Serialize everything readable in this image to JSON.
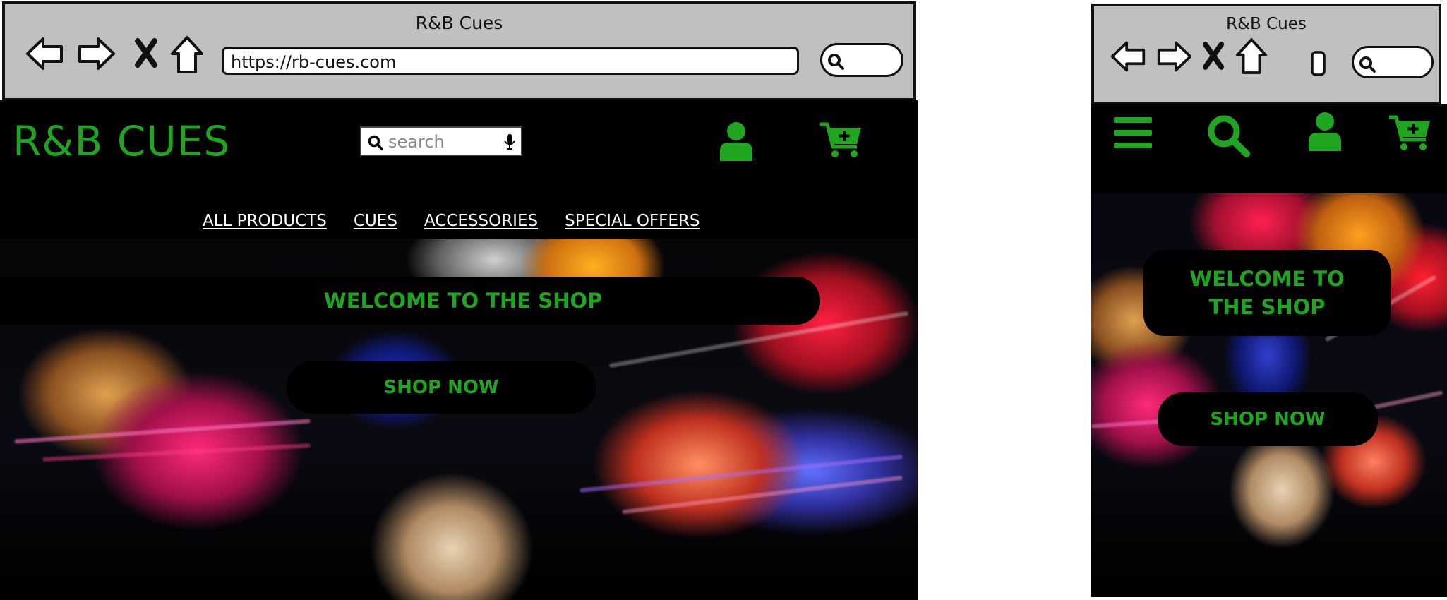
{
  "colors": {
    "accent": "#1fa51f",
    "site_bg": "#000000",
    "chrome_bg": "#c0c0c0"
  },
  "desktop": {
    "browser": {
      "tab_title": "R&B Cues",
      "url": "https://rb-cues.com",
      "icons": [
        "back-arrow-icon",
        "forward-arrow-icon",
        "close-x-icon",
        "home-icon",
        "search-icon"
      ]
    },
    "header": {
      "logo": "R&B CUES",
      "search_placeholder": "search",
      "icons": [
        "search-icon",
        "microphone-icon",
        "user-icon",
        "cart-plus-icon"
      ]
    },
    "nav": [
      "ALL PRODUCTS",
      "CUES",
      "ACCESSORIES",
      "SPECIAL OFFERS"
    ],
    "hero": {
      "welcome": "WELCOME TO THE SHOP",
      "cta": "SHOP NOW"
    }
  },
  "mobile": {
    "browser": {
      "tab_title": "R&B Cues",
      "icons": [
        "back-arrow-icon",
        "forward-arrow-icon",
        "close-x-icon",
        "home-icon",
        "tabs-icon",
        "search-icon"
      ]
    },
    "header": {
      "icons": [
        "hamburger-menu-icon",
        "search-icon",
        "user-icon",
        "cart-plus-icon"
      ]
    },
    "hero": {
      "welcome": "WELCOME TO THE SHOP",
      "cta": "SHOP NOW"
    }
  }
}
